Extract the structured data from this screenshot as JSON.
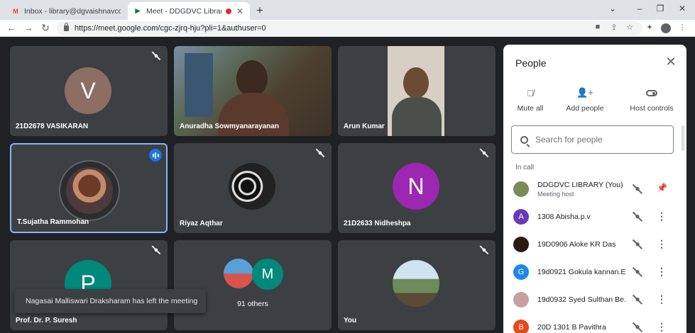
{
  "browser": {
    "tabs": [
      {
        "favicon": "M",
        "title": "Inbox - library@dgvaishnavcolle",
        "color": "#ea4335"
      },
      {
        "favicon": "▶",
        "title": "Meet - DDGDVC Library ND",
        "color": "#00832d",
        "recording": true
      }
    ],
    "new_tab": "+",
    "window_controls": [
      "⌄",
      "–",
      "❐",
      "✕"
    ],
    "url": "https://meet.google.com/cgc-zjrq-hju?pli=1&authuser=0"
  },
  "tiles": [
    {
      "name": "21D2678 VASIKARAN",
      "avatar_letter": "V",
      "avatar_color": "#8d6e63",
      "muted": true
    },
    {
      "name": "Anuradha Sowmyanarayanan",
      "type": "video"
    },
    {
      "name": "Arun Kumar",
      "type": "video"
    },
    {
      "name": "T.Sujatha Rammohan",
      "type": "photo",
      "speaking": true
    },
    {
      "name": "Riyaz Aqthar",
      "type": "photo",
      "muted": true
    },
    {
      "name": "21D2633 Nidheshpa",
      "avatar_letter": "N",
      "avatar_color": "#9c27b0",
      "muted": true
    },
    {
      "name": "Prof. Dr. P. Suresh",
      "avatar_letter": "P",
      "avatar_color": "#00897b",
      "muted": true
    },
    {
      "name": "91 others",
      "avatar_letter": "M",
      "avatar_color": "#00897b"
    },
    {
      "name": "You",
      "type": "photo",
      "muted": true
    }
  ],
  "toast": "Nagasai Malliswari Draksharam has left the meeting",
  "people_panel": {
    "title": "People",
    "actions": [
      {
        "label": "Mute all",
        "icon": "mic-off-icon"
      },
      {
        "label": "Add people",
        "icon": "add-person-icon"
      },
      {
        "label": "Host controls",
        "icon": "toggle-icon"
      }
    ],
    "search_placeholder": "Search for people",
    "section": "In call",
    "participants": [
      {
        "name": "DDGDVC LIBRARY (You)",
        "sub": "Meeting host",
        "avatar_color": "#7b8a5a",
        "letter": "",
        "action": "pin"
      },
      {
        "name": "1308 Abisha.p.v",
        "sub": "",
        "avatar_color": "#673ab7",
        "letter": "A",
        "action": "more"
      },
      {
        "name": "19D0906 Aloke KR Das",
        "sub": "",
        "avatar_color": "#2b1a12",
        "letter": "",
        "action": "more"
      },
      {
        "name": "19d0921 Gokula kannan.E",
        "sub": "",
        "avatar_color": "#1e88e5",
        "letter": "G",
        "action": "more"
      },
      {
        "name": "19d0932 Syed Sulthan Be...",
        "sub": "",
        "avatar_color": "#c9a0a0",
        "letter": "",
        "action": "more"
      },
      {
        "name": "20D 1301 B Pavithra",
        "sub": "",
        "avatar_color": "#e64a19",
        "letter": "B",
        "action": "more"
      }
    ]
  }
}
